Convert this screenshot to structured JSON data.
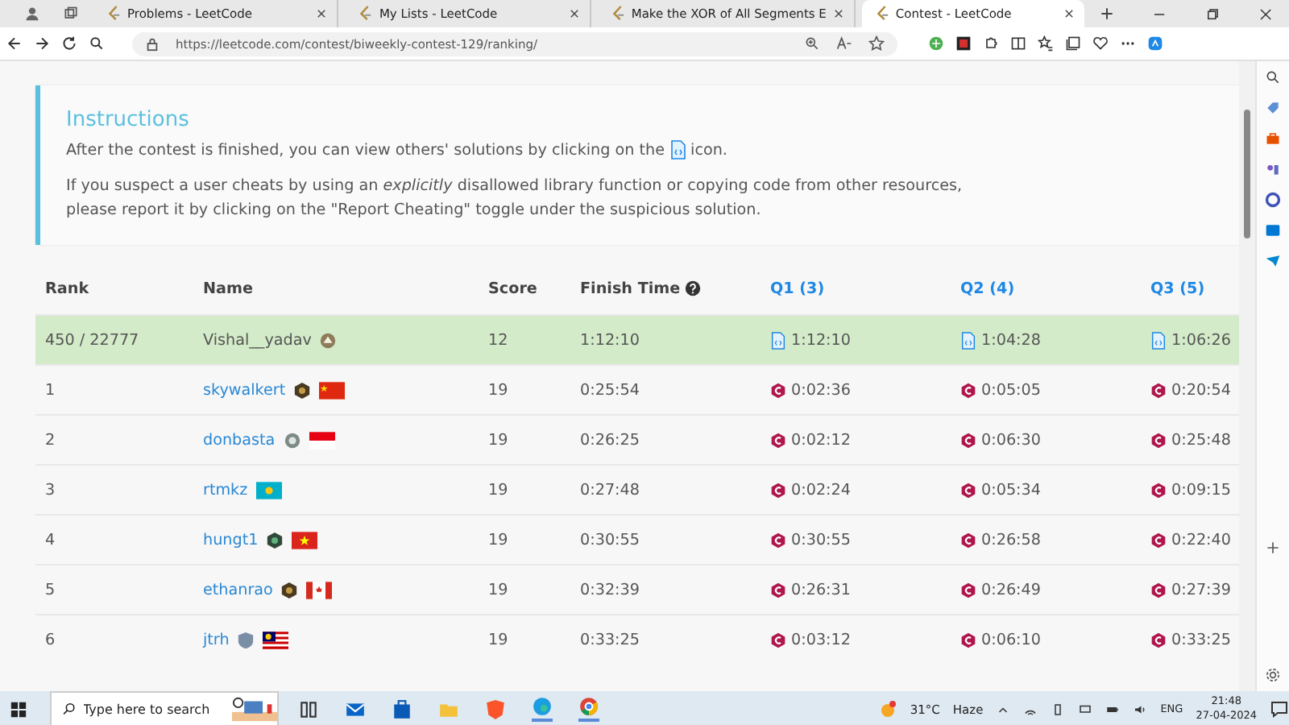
{
  "tabs": [
    {
      "title": "Problems - LeetCode",
      "selected": false
    },
    {
      "title": "My Lists - LeetCode",
      "selected": false
    },
    {
      "title": "Make the XOR of All Segments E",
      "selected": false
    },
    {
      "title": "Contest - LeetCode",
      "selected": true
    }
  ],
  "address_bar": {
    "url": "https://leetcode.com/contest/biweekly-contest-129/ranking/"
  },
  "instructions": {
    "title": "Instructions",
    "line_1_before": "After the contest is finished, you can view others' solutions by clicking on the",
    "line_1_after": "icon.",
    "paragraph_2": "If you suspect a user cheats by using an *explicitly* disallowed library function or copying code from other resources, please report it by clicking on the \"Report Cheating\" toggle under the suspicious solution."
  },
  "table": {
    "columns": [
      {
        "label": "Rank",
        "kind": "plain"
      },
      {
        "label": "Name",
        "kind": "plain"
      },
      {
        "label": "Score",
        "kind": "plain"
      },
      {
        "label": "Finish Time",
        "kind": "help"
      },
      {
        "label": "Q1 (3)",
        "kind": "question"
      },
      {
        "label": "Q2 (4)",
        "kind": "question"
      },
      {
        "label": "Q3 (5)",
        "kind": "question"
      }
    ],
    "rows": [
      {
        "highlighted": true,
        "rank": "450 / 22777",
        "name": "Vishal__yadav",
        "icons": [
          {
            "kind": "badge_guardian"
          }
        ],
        "score": "12",
        "finish": "1:12:10",
        "q": [
          {
            "kind": "solution",
            "time": "1:12:10"
          },
          {
            "kind": "solution",
            "time": "1:04:28"
          },
          {
            "kind": "solution",
            "time": "1:06:26"
          }
        ]
      },
      {
        "highlighted": false,
        "rank": "1",
        "name": "skywalkert",
        "icons": [
          {
            "kind": "badge_dark"
          },
          {
            "kind": "flag_china"
          }
        ],
        "score": "19",
        "finish": "0:25:54",
        "q": [
          {
            "kind": "cpp",
            "time": "0:02:36"
          },
          {
            "kind": "cpp",
            "time": "0:05:05"
          },
          {
            "kind": "cpp",
            "time": "0:20:54"
          }
        ]
      },
      {
        "highlighted": false,
        "rank": "2",
        "name": "donbasta",
        "icons": [
          {
            "kind": "badge_grey"
          },
          {
            "kind": "flag_indonesia"
          }
        ],
        "score": "19",
        "finish": "0:26:25",
        "q": [
          {
            "kind": "cpp",
            "time": "0:02:12"
          },
          {
            "kind": "cpp",
            "time": "0:06:30"
          },
          {
            "kind": "cpp",
            "time": "0:25:48"
          }
        ]
      },
      {
        "highlighted": false,
        "rank": "3",
        "name": "rtmkz",
        "icons": [
          {
            "kind": "flag_kazakhstan"
          }
        ],
        "score": "19",
        "finish": "0:27:48",
        "q": [
          {
            "kind": "cpp",
            "time": "0:02:24"
          },
          {
            "kind": "cpp",
            "time": "0:05:34"
          },
          {
            "kind": "cpp",
            "time": "0:09:15"
          }
        ]
      },
      {
        "highlighted": false,
        "rank": "4",
        "name": "hungt1",
        "icons": [
          {
            "kind": "badge_green"
          },
          {
            "kind": "flag_vietnam"
          }
        ],
        "score": "19",
        "finish": "0:30:55",
        "q": [
          {
            "kind": "cpp",
            "time": "0:30:55"
          },
          {
            "kind": "cpp",
            "time": "0:26:58"
          },
          {
            "kind": "cpp",
            "time": "0:22:40"
          }
        ]
      },
      {
        "highlighted": false,
        "rank": "5",
        "name": "ethanrao",
        "icons": [
          {
            "kind": "badge_dark"
          },
          {
            "kind": "flag_canada"
          }
        ],
        "score": "19",
        "finish": "0:32:39",
        "q": [
          {
            "kind": "cpp",
            "time": "0:26:31"
          },
          {
            "kind": "cpp",
            "time": "0:26:49"
          },
          {
            "kind": "cpp",
            "time": "0:27:39"
          }
        ]
      },
      {
        "highlighted": false,
        "rank": "6",
        "name": "jtrh",
        "icons": [
          {
            "kind": "badge_shield"
          },
          {
            "kind": "flag_malaysia"
          }
        ],
        "score": "19",
        "finish": "0:33:25",
        "q": [
          {
            "kind": "cpp",
            "time": "0:03:12"
          },
          {
            "kind": "cpp",
            "time": "0:06:10"
          },
          {
            "kind": "cpp",
            "time": "0:33:25"
          }
        ]
      }
    ]
  },
  "taskbar": {
    "search_placeholder": "Type here to search",
    "weather": "31°C",
    "condition": "Haze",
    "language": "ENG",
    "time": "21:48",
    "date": "27-04-2024"
  }
}
